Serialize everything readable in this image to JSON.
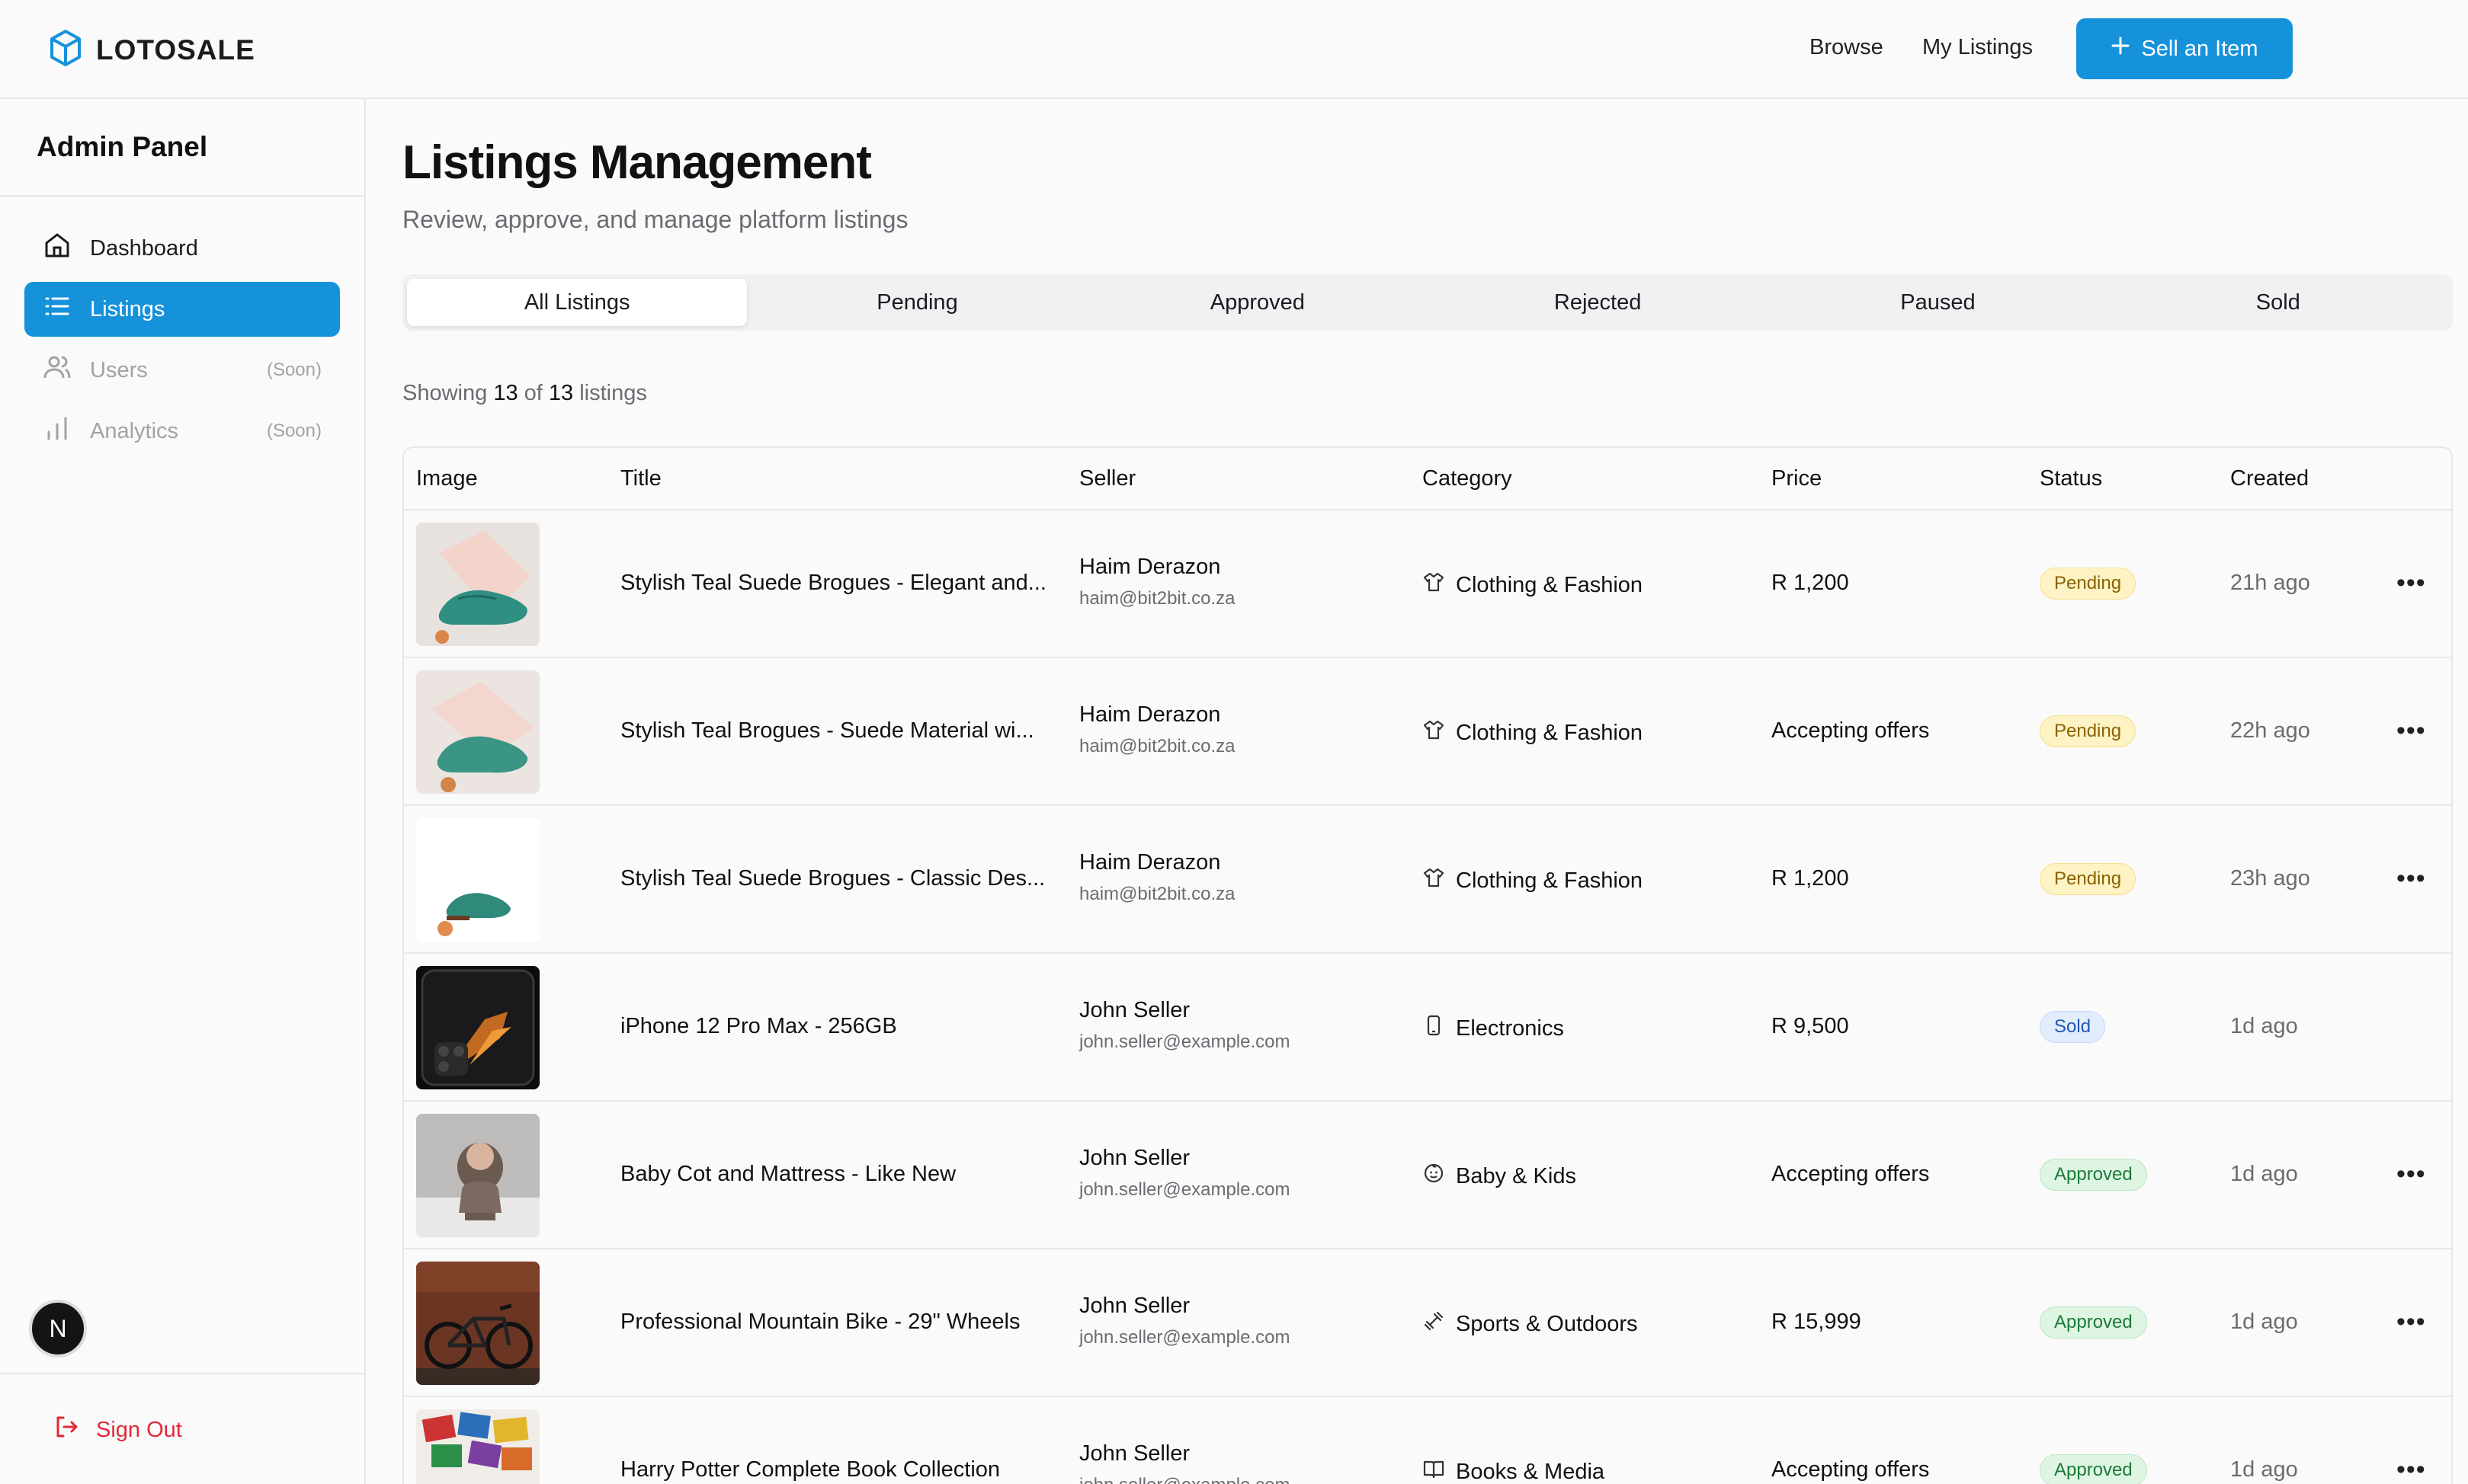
{
  "app": {
    "brand": "LOTOSALE",
    "accent": "#1692db"
  },
  "nav": {
    "browse": "Browse",
    "my_listings": "My Listings",
    "sell": "Sell an Item"
  },
  "sidebar": {
    "title": "Admin Panel",
    "items": [
      {
        "label": "Dashboard",
        "soon": ""
      },
      {
        "label": "Listings",
        "soon": ""
      },
      {
        "label": "Users",
        "soon": "(Soon)"
      },
      {
        "label": "Analytics",
        "soon": "(Soon)"
      }
    ],
    "avatar": "N",
    "sign_out": "Sign Out"
  },
  "main": {
    "title": "Listings Management",
    "subtitle": "Review, approve, and manage platform listings",
    "tabs": [
      "All Listings",
      "Pending",
      "Approved",
      "Rejected",
      "Paused",
      "Sold"
    ],
    "showing": {
      "prefix": "Showing",
      "count": "13",
      "of": "of",
      "total": "13",
      "suffix": "listings"
    }
  },
  "table": {
    "headers": [
      "Image",
      "Title",
      "Seller",
      "Category",
      "Price",
      "Status",
      "Created"
    ],
    "rows": [
      {
        "title": "Stylish Teal Suede Brogues - Elegant and...",
        "seller": "Haim Derazon",
        "email": "haim@bit2bit.co.za",
        "category": "Clothing & Fashion",
        "cat_icon": "shirt-icon",
        "price": "R 1,200",
        "status": "Pending",
        "created": "21h ago"
      },
      {
        "title": "Stylish Teal Brogues - Suede Material wi...",
        "seller": "Haim Derazon",
        "email": "haim@bit2bit.co.za",
        "category": "Clothing & Fashion",
        "cat_icon": "shirt-icon",
        "price": "Accepting offers",
        "status": "Pending",
        "created": "22h ago"
      },
      {
        "title": "Stylish Teal Suede Brogues - Classic Des...",
        "seller": "Haim Derazon",
        "email": "haim@bit2bit.co.za",
        "category": "Clothing & Fashion",
        "cat_icon": "shirt-icon",
        "price": "R 1,200",
        "status": "Pending",
        "created": "23h ago"
      },
      {
        "title": "iPhone 12 Pro Max - 256GB",
        "seller": "John Seller",
        "email": "john.seller@example.com",
        "category": "Electronics",
        "cat_icon": "phone-icon",
        "price": "R 9,500",
        "status": "Sold",
        "created": "1d ago"
      },
      {
        "title": "Baby Cot and Mattress - Like New",
        "seller": "John Seller",
        "email": "john.seller@example.com",
        "category": "Baby & Kids",
        "cat_icon": "baby-icon",
        "price": "Accepting offers",
        "status": "Approved",
        "created": "1d ago"
      },
      {
        "title": "Professional Mountain Bike - 29\" Wheels",
        "seller": "John Seller",
        "email": "john.seller@example.com",
        "category": "Sports & Outdoors",
        "cat_icon": "dumbbell-icon",
        "price": "R 15,999",
        "status": "Approved",
        "created": "1d ago"
      },
      {
        "title": "Harry Potter Complete Book Collection",
        "seller": "John Seller",
        "email": "john.seller@example.com",
        "category": "Books & Media",
        "cat_icon": "book-icon",
        "price": "Accepting offers",
        "status": "Approved",
        "created": "1d ago"
      }
    ]
  }
}
